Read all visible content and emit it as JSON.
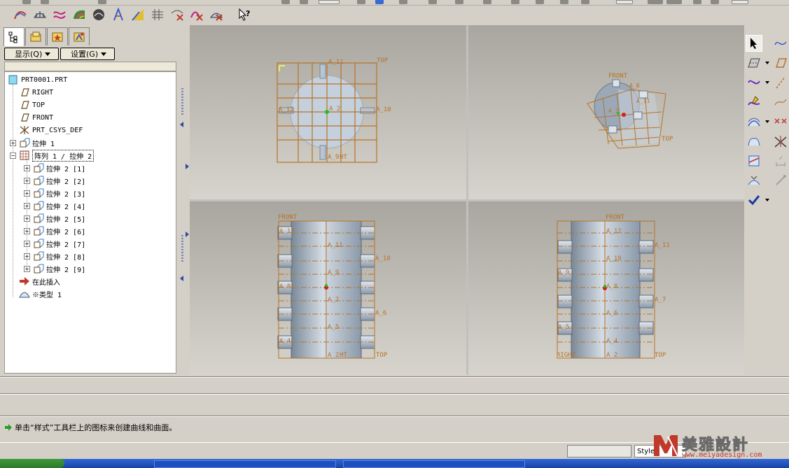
{
  "panel": {
    "show_btn": "显示(Q)",
    "settings_btn": "设置(G)"
  },
  "tree": {
    "root": "PRT0001.PRT",
    "items": [
      {
        "label": "RIGHT",
        "icon": "datum-plane-icon"
      },
      {
        "label": "TOP",
        "icon": "datum-plane-icon"
      },
      {
        "label": "FRONT",
        "icon": "datum-plane-icon"
      },
      {
        "label": "PRT_CSYS_DEF",
        "icon": "csys-icon"
      },
      {
        "label": "拉伸 1",
        "icon": "extrude-icon"
      },
      {
        "label": "阵列 1 / 拉伸 2",
        "icon": "pattern-icon"
      }
    ],
    "pattern_children": [
      "拉伸 2 [1]",
      "拉伸 2 [2]",
      "拉伸 2 [3]",
      "拉伸 2 [4]",
      "拉伸 2 [5]",
      "拉伸 2 [6]",
      "拉伸 2 [7]",
      "拉伸 2 [8]",
      "拉伸 2 [9]"
    ],
    "insert_here": "在此插入",
    "type_item": "※类型 1"
  },
  "views": {
    "top_view": {
      "lbl_top": "TOP",
      "lbl_a11": "A_11",
      "lbl_a12": "A_12",
      "lbl_a2": "A_2",
      "lbl_a10": "A_10",
      "lbl_a9": "A_9",
      "lbl_ht": "HT"
    },
    "iso_view": {
      "lbl_front": "FRONT",
      "lbl_a8": "A_8",
      "lbl_a11": "A_11",
      "lbl_top": "TOP",
      "lbl_a2": "A_2"
    },
    "front_view": {
      "lbl_front": "FRONT",
      "lbl_top": "TOP",
      "labels": [
        "A_12",
        "A_11",
        "A_10",
        "A_9",
        "A_8",
        "A_7",
        "A_6",
        "A_5",
        "A_4",
        "A_2",
        "HT"
      ]
    },
    "side_view": {
      "lbl_front": "FRONT",
      "lbl_top": "TOP",
      "lbl_right": "RIGHT",
      "labels": [
        "A_12",
        "A_11",
        "A_10",
        "A_9",
        "A_8",
        "A_7",
        "A_6",
        "A_5",
        "A_4",
        "A_2"
      ]
    }
  },
  "status": {
    "message": "单击“样式”工具栏上的图标来创建曲线和曲面。",
    "style_field": "Style"
  },
  "watermark": {
    "brand": "美雅設計",
    "url": "www.meiyadesign.com"
  },
  "colors": {
    "datum": "#b8732a",
    "cylinder": "#a9b8c8",
    "background_top": "#a8a69e",
    "accent_green": "#2a9a2a"
  }
}
